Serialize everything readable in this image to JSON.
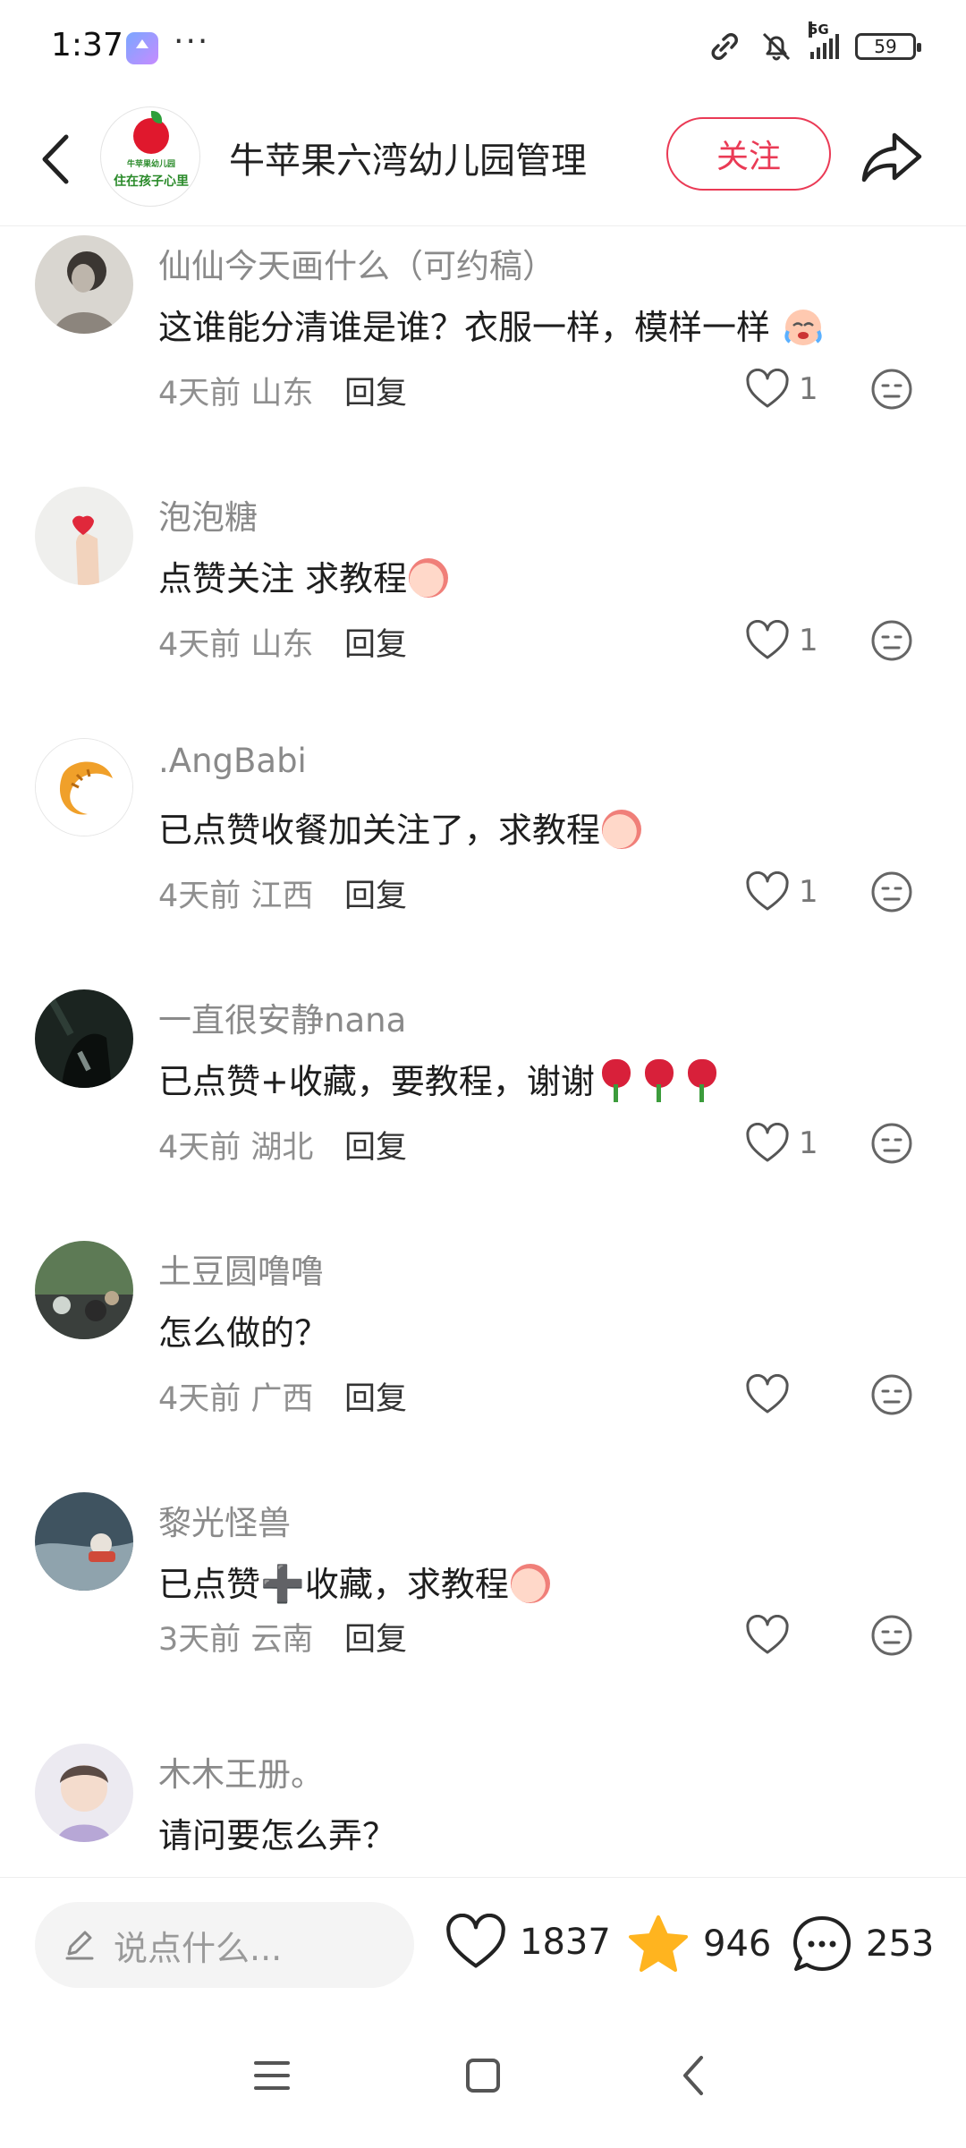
{
  "status_bar": {
    "time": "1:37",
    "more": "···",
    "network": "5G",
    "battery": "59"
  },
  "header": {
    "shop_name": "牛苹果六湾幼儿园管理",
    "logo_text_top": "牛苹果幼儿园",
    "logo_text_bottom": "住在孩子心里",
    "follow_label": "关注"
  },
  "comments": [
    {
      "name": "仙仙今天画什么（可约稿）",
      "text": "这谁能分清谁是谁？衣服一样，模样一样",
      "emoji": "crying-face",
      "time": "4天前",
      "location": "山东",
      "reply": "回复",
      "likes": "1"
    },
    {
      "name": "泡泡糖",
      "text": "点赞关注 求教程",
      "emoji": "peach",
      "time": "4天前",
      "location": "山东",
      "reply": "回复",
      "likes": "1"
    },
    {
      "name": ".AngBabi",
      "text": "已点赞收餐加关注了，求教程",
      "emoji": "peach",
      "time": "4天前",
      "location": "江西",
      "reply": "回复",
      "likes": "1"
    },
    {
      "name": "一直很安静nana",
      "text": "已点赞+收藏，要教程，谢谢",
      "emoji": "roses",
      "time": "4天前",
      "location": "湖北",
      "reply": "回复",
      "likes": "1"
    },
    {
      "name": "土豆圆噜噜",
      "text": "怎么做的？",
      "emoji": "",
      "time": "4天前",
      "location": "广西",
      "reply": "回复",
      "likes": ""
    },
    {
      "name": "黎光怪兽",
      "text_a": "已点赞",
      "plus": "➕",
      "text": "收藏，求教程",
      "emoji": "peach",
      "time": "3天前",
      "location": "云南",
      "reply": "回复",
      "likes": ""
    },
    {
      "name": "木木王册。",
      "text": "请问要怎么弄？"
    }
  ],
  "bottom_bar": {
    "input_placeholder": "说点什么...",
    "likes": "1837",
    "stars": "946",
    "comments": "253"
  },
  "colors": {
    "accent": "#ea3a55",
    "star": "#ffb41f",
    "muted_text": "#8a8a8a"
  }
}
